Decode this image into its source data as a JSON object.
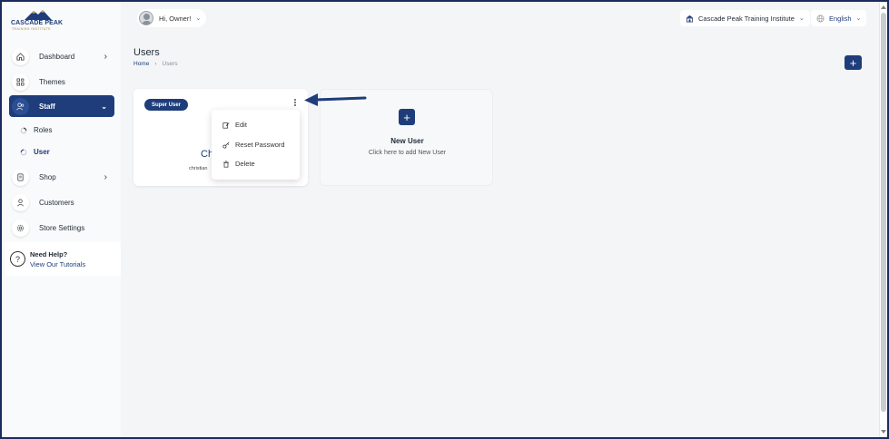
{
  "brand": {
    "name": "CASCADE PEAK",
    "tagline": "TRAINING INSTITUTE"
  },
  "header": {
    "greeting": "Hi, Owner!",
    "institute": "Cascade Peak Training Institute",
    "language": "English"
  },
  "sidebar": {
    "items": [
      {
        "label": "Dashboard",
        "icon": "home-icon"
      },
      {
        "label": "Themes",
        "icon": "themes-icon"
      },
      {
        "label": "Staff",
        "icon": "staff-icon"
      },
      {
        "label": "Shop",
        "icon": "shop-icon"
      },
      {
        "label": "Customers",
        "icon": "customer-icon"
      },
      {
        "label": "Store Settings",
        "icon": "settings-icon"
      }
    ],
    "sub_items": [
      {
        "label": "Roles"
      },
      {
        "label": "User"
      }
    ],
    "help": {
      "title": "Need Help?",
      "link": "View Our Tutorials"
    }
  },
  "page": {
    "title": "Users",
    "breadcrumb_home": "Home",
    "breadcrumb_current": "Users"
  },
  "user_card": {
    "badge": "Super User",
    "name": "Ch",
    "email": "christian"
  },
  "menu": {
    "edit": "Edit",
    "reset_password": "Reset Password",
    "delete": "Delete"
  },
  "new_user": {
    "title": "New User",
    "subtitle": "Click here to add New User"
  },
  "colors": {
    "primary": "#1e3d7a",
    "background": "#f4f5f7"
  }
}
